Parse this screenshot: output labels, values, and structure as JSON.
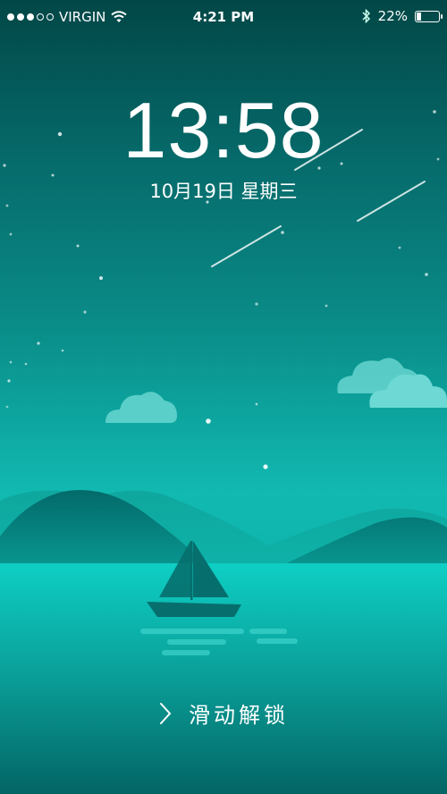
{
  "status": {
    "carrier": "VIRGIN",
    "signal_bars_filled": 3,
    "signal_bars_total": 5,
    "time": "4:21 PM",
    "battery": "22%",
    "battery_level": 0.22,
    "icons": [
      "wifi-icon",
      "bluetooth-icon",
      "battery-icon"
    ]
  },
  "lockscreen": {
    "time": "13:58",
    "date": "10月19日 星期三",
    "unlock_text": "滑动解锁",
    "unlock_icon": "chevron-right-icon"
  },
  "colors": {
    "sky_top": "#024747",
    "sea": "#11b9b1",
    "mountain_dark": "#037777"
  }
}
